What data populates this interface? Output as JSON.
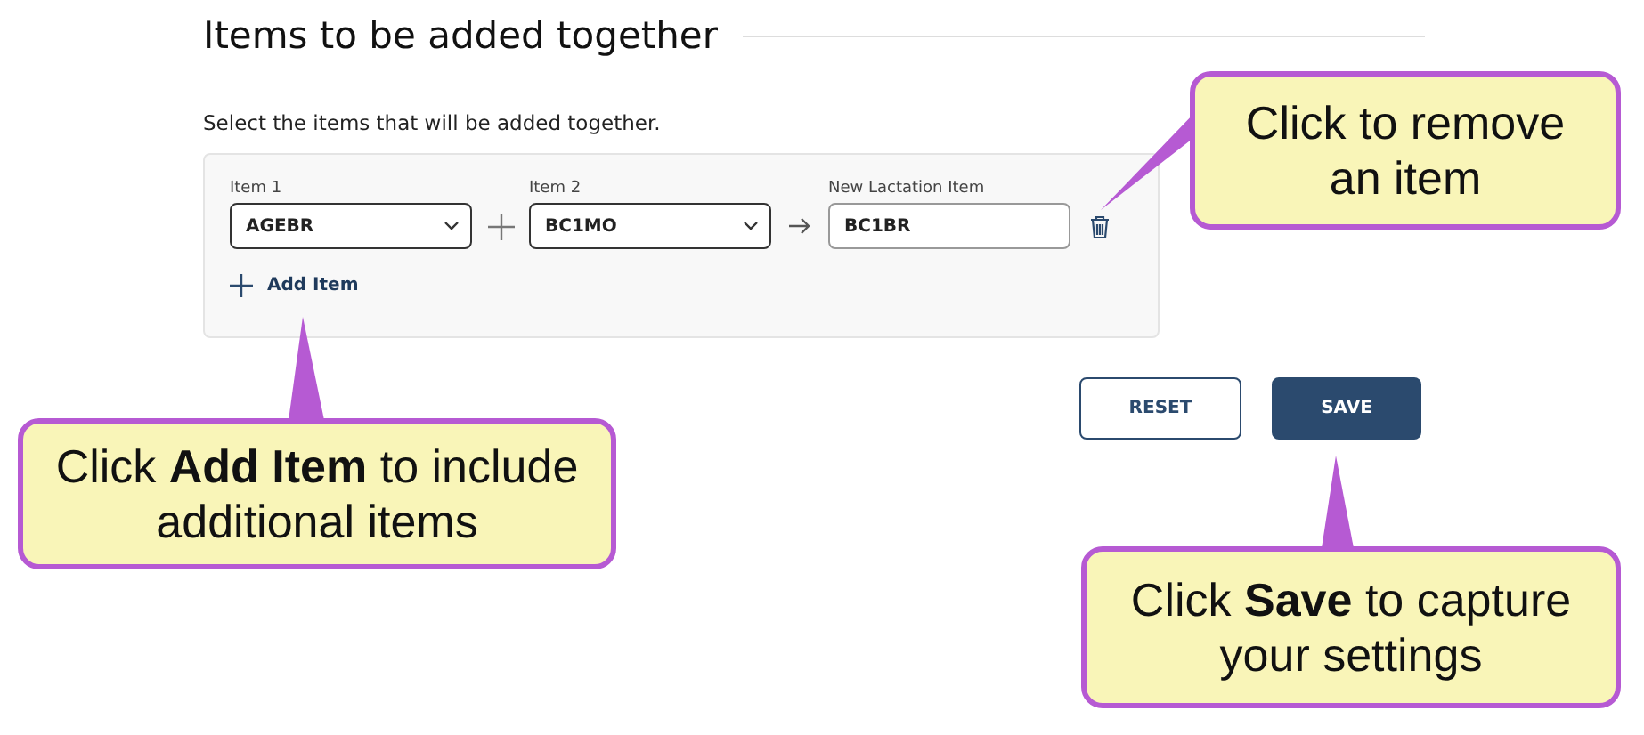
{
  "section": {
    "title": "Items to be added together",
    "description": "Select the items that will be added together."
  },
  "combination": {
    "fields": [
      {
        "kind": "select",
        "label": "Item 1",
        "value": "AGEBR"
      },
      {
        "kind": "select",
        "label": "Item 2",
        "value": "BC1MO"
      },
      {
        "kind": "text",
        "label": "New Lactation Item",
        "value": "BC1BR"
      }
    ],
    "add_link": "Add Item"
  },
  "buttons": [
    {
      "kind": "secondary",
      "label": "RESET"
    },
    {
      "kind": "primary",
      "label": "SAVE"
    }
  ],
  "callouts": [
    {
      "text": "Click to remove an item"
    },
    {
      "text": "Click **Add Item** to include additional items"
    },
    {
      "text": "Click **Save** to capture your settings"
    }
  ]
}
